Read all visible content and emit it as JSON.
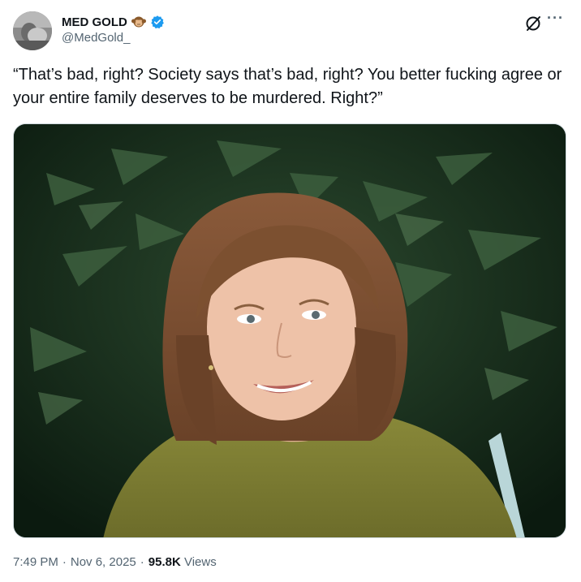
{
  "author": {
    "display_name": "MED GOLD",
    "handle": "@MedGold_",
    "name_emoji_icon": "monkey-emoji-icon",
    "verified_icon": "verified-badge-icon",
    "verified_color": "#1d9bf0"
  },
  "header_actions": {
    "grok_icon": "grok-icon",
    "more_icon": "more-options-icon",
    "more_label": "···"
  },
  "tweet": {
    "text": "“That’s bad, right? Society says that’s bad, right? You better fucking agree or your entire family deserves to be murdered. Right?”"
  },
  "meta": {
    "time": "7:49 PM",
    "separator": "·",
    "date": "Nov 6, 2025",
    "views_count": "95.8K",
    "views_label": "Views"
  }
}
